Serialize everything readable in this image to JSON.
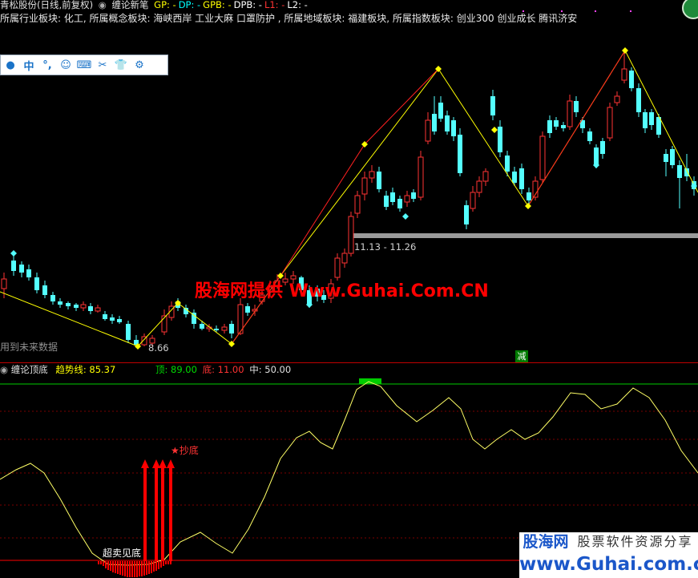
{
  "header": {
    "stock": "青松股份(日线,前复权)",
    "indicator": "缠论新笔",
    "fields": [
      {
        "label": "GP:",
        "value": "-",
        "color": "#ffff00"
      },
      {
        "label": "DP:",
        "value": "-",
        "color": "#00ffff"
      },
      {
        "label": "GPB:",
        "value": "-",
        "color": "#ffff00"
      },
      {
        "label": "DPB:",
        "value": "-",
        "color": "#ffffff"
      },
      {
        "label": "L1:",
        "value": "-",
        "color": "#ff3333"
      },
      {
        "label": "L2:",
        "value": "-",
        "color": "#ffffff"
      }
    ]
  },
  "sector_line": "所属行业板块: 化工, 所属概念板块: 海峡西岸 工业大麻 口罩防护 , 所属地域板块: 福建板块, 所属指数板块: 创业300 创业成长 腾讯济安",
  "toolbar": {
    "buttons": [
      {
        "name": "user-icon",
        "glyph": "●"
      },
      {
        "name": "chinese-input-icon",
        "glyph": "中"
      },
      {
        "name": "punctuation-icon",
        "glyph": "°,"
      },
      {
        "name": "smiley-icon",
        "glyph": "☺"
      },
      {
        "name": "keyboard-icon",
        "glyph": "⌨"
      },
      {
        "name": "scissors-icon",
        "glyph": "✂"
      },
      {
        "name": "shirt-icon",
        "glyph": "👕"
      },
      {
        "name": "gear-icon",
        "glyph": "⚙"
      }
    ]
  },
  "main_chart": {
    "range_label": "11.13 - 11.26",
    "low_label": "8.66",
    "future_data_label": "用到未来数据",
    "reduce_badge": "减",
    "watermark": "股海网提供 Www.Guhai.Com.CN"
  },
  "indicator_panel": {
    "name": "缠论顶底",
    "trend_label": "趋势线:",
    "trend_value": "85.37",
    "top_label": "顶:",
    "top_value": "89.00",
    "bottom_label": "底:",
    "bottom_value": "11.00",
    "mid_label": "中:",
    "mid_value": "50.00",
    "buy_signal": "★抄底",
    "oversold_label": "超卖见底"
  },
  "branding": {
    "name": "股海网",
    "slogan": "股票软件资源分享",
    "url": "www.Guhai.com.cn"
  },
  "colors": {
    "up_candle": "#ff3333",
    "down_candle": "#54ffff",
    "stroke_line": "#ffff00",
    "upper_line": "#ff2020",
    "separator": "#c00000",
    "indicator_line": "#ffff66",
    "top_line": "#00cc00",
    "bottom_line": "#ff0000"
  }
}
